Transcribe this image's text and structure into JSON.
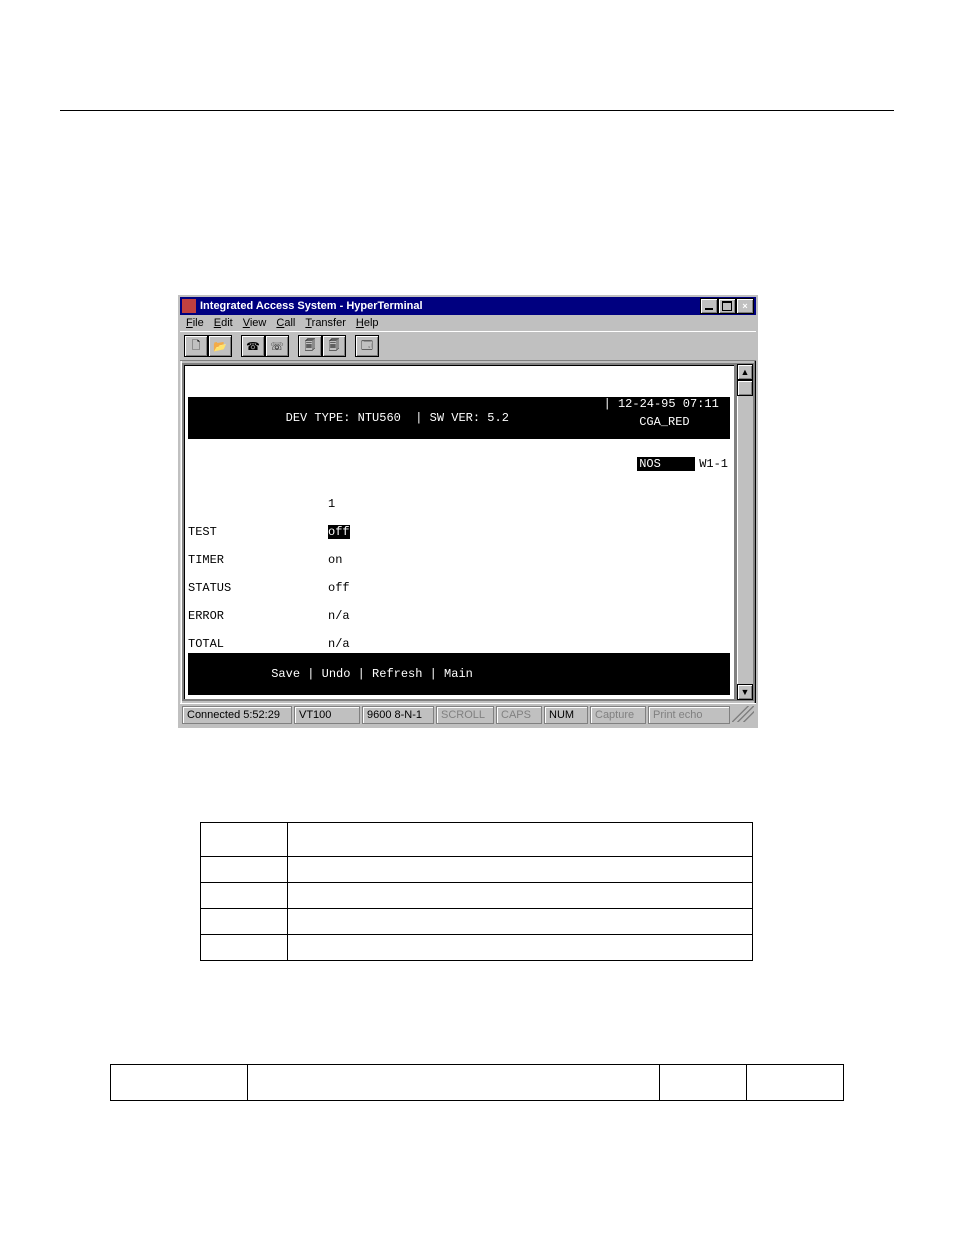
{
  "window": {
    "title": "Integrated Access System - HyperTerminal",
    "menus": {
      "file": "File",
      "edit": "Edit",
      "view": "View",
      "call": "Call",
      "transfer": "Transfer",
      "help": "Help"
    }
  },
  "terminal": {
    "dev_type_label": "DEV TYPE:",
    "dev_type_value": "NTU560",
    "sw_ver_label": "SW VER:",
    "sw_ver_value": "5.2",
    "datetime": "12-24-95 07:11",
    "col_header": "1",
    "rows": [
      {
        "label": "TEST",
        "value": "off",
        "inv": true
      },
      {
        "label": "TIMER",
        "value": "on",
        "inv": false
      },
      {
        "label": "STATUS",
        "value": "off",
        "inv": false
      },
      {
        "label": "ERROR",
        "value": "n/a",
        "inv": false
      },
      {
        "label": "TOTAL",
        "value": "n/a",
        "inv": false
      }
    ],
    "alarms": [
      {
        "label": "CGA_RED",
        "value": "W1-1"
      },
      {
        "label": "NOS",
        "value": "W1-1"
      }
    ],
    "footer": "Save | Undo | Refresh | Main"
  },
  "statusbar": {
    "connected": "Connected 5:52:29",
    "emulation": "VT100",
    "config": "9600 8-N-1",
    "scroll": "SCROLL",
    "caps": "CAPS",
    "num": "NUM",
    "capture": "Capture",
    "printecho": "Print echo"
  }
}
